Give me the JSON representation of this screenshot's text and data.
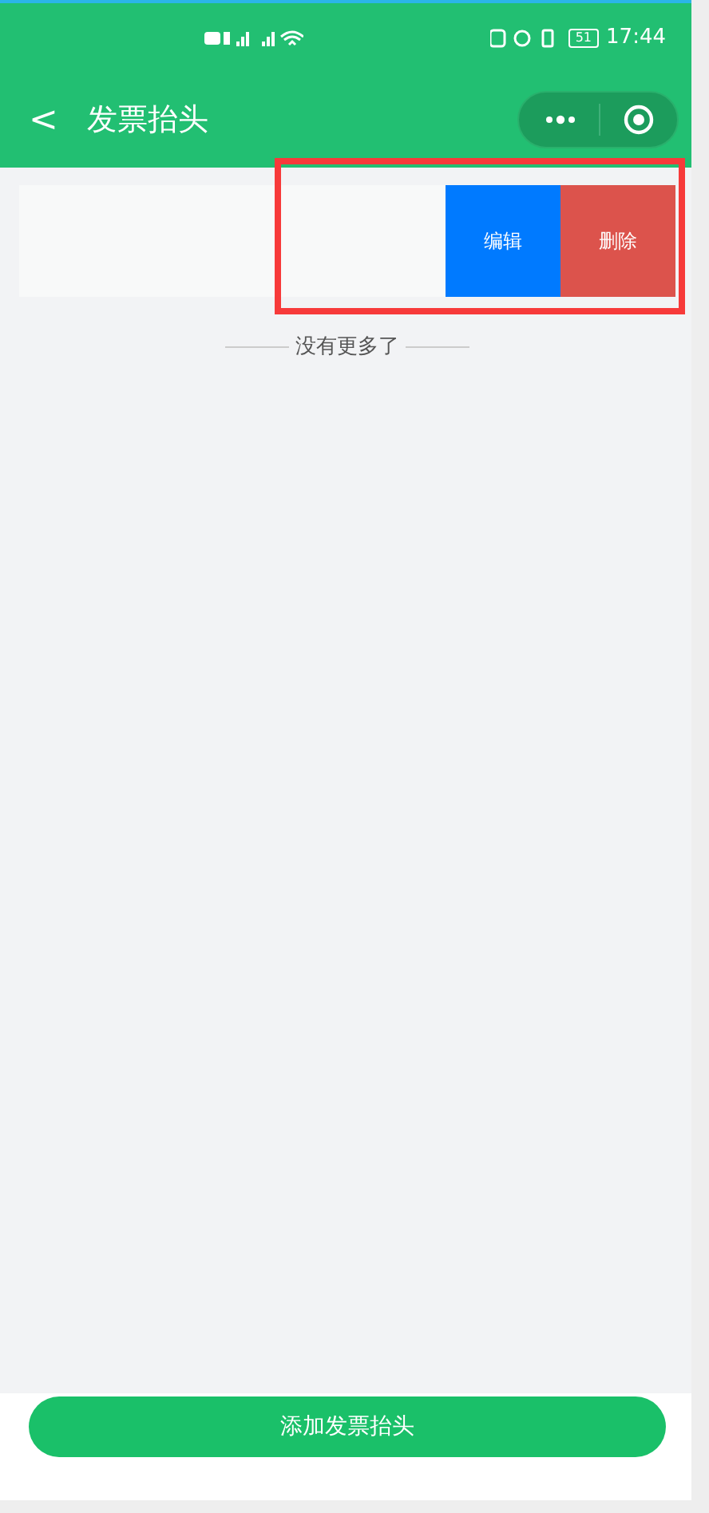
{
  "status_bar": {
    "battery": "51",
    "time": "17:44"
  },
  "nav": {
    "back": "<",
    "title": "发票抬头"
  },
  "invoice_items": [
    {
      "actions": [
        {
          "kind": "edit",
          "label": "编辑"
        },
        {
          "kind": "delete",
          "label": "删除"
        }
      ]
    }
  ],
  "end_text": "没有更多了",
  "add_button": "添加发票抬头"
}
